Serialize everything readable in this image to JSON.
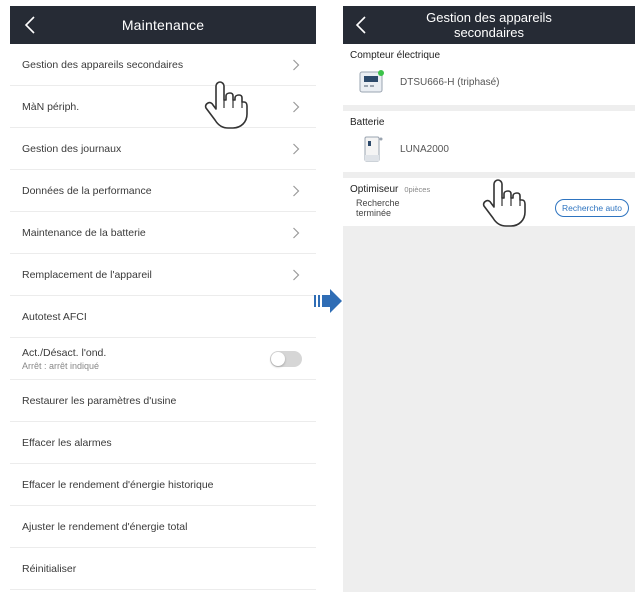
{
  "left": {
    "title": "Maintenance",
    "items": [
      {
        "label": "Gestion des appareils secondaires",
        "chevron": true
      },
      {
        "label": "MàN périph.",
        "chevron": true
      },
      {
        "label": "Gestion des journaux",
        "chevron": true
      },
      {
        "label": "Données de la performance",
        "chevron": true
      },
      {
        "label": "Maintenance de la batterie",
        "chevron": true
      },
      {
        "label": "Remplacement de l'appareil",
        "chevron": true
      },
      {
        "label": "Autotest AFCI",
        "chevron": false
      },
      {
        "label": "Act./Désact. l'ond.",
        "sub": "Arrêt : arrêt indiqué",
        "toggle": "off"
      },
      {
        "label": "Restaurer les paramètres d'usine",
        "chevron": false
      },
      {
        "label": "Effacer les alarmes",
        "chevron": false
      },
      {
        "label": "Effacer le rendement d'énergie historique",
        "chevron": false
      },
      {
        "label": "Ajuster le rendement d'énergie total",
        "chevron": false
      },
      {
        "label": "Réinitialiser",
        "chevron": false
      }
    ]
  },
  "right": {
    "title": "Gestion des appareils secondaires",
    "meter": {
      "section": "Compteur électrique",
      "device": "DTSU666-H (triphasé)"
    },
    "battery": {
      "section": "Batterie",
      "device": "LUNA2000"
    },
    "optimizer": {
      "section": "Optimiseur",
      "count": "0pièces",
      "status": "Recherche terminée",
      "button": "Recherche auto"
    }
  },
  "colors": {
    "header": "#262b35",
    "accent": "#2e74c0",
    "arrow": "#2f6db5",
    "meter_dot": "#3cc34a"
  },
  "icons": [
    "back-chevron-icon",
    "chevron-right-icon",
    "pointing-hand-icon",
    "transition-arrow-icon",
    "meter-icon",
    "battery-icon"
  ]
}
